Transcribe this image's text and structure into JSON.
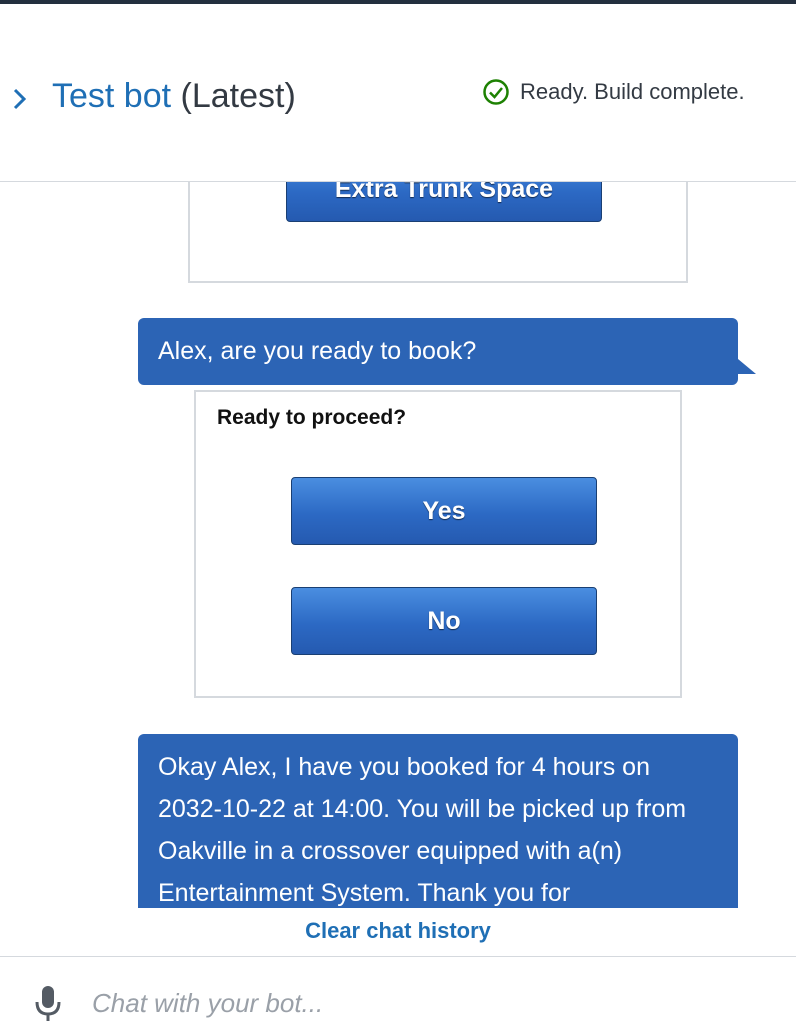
{
  "header": {
    "title_link": "Test bot",
    "title_version": "(Latest)",
    "status_text": "Ready. Build complete."
  },
  "chat": {
    "card1": {
      "button_label": "Extra Trunk Space"
    },
    "bot_message_1": "Alex, are you ready to book?",
    "card2": {
      "title": "Ready to proceed?",
      "buttons": [
        "Yes",
        "No"
      ]
    },
    "bot_message_2": "Okay Alex, I have you booked for 4 hours on 2032-10-22 at 14:00. You will be picked up from Oakville in a crossover equipped with a(n) Entertainment System. Thank you for"
  },
  "clear_history_label": "Clear chat history",
  "input": {
    "placeholder": "Chat with your bot...",
    "value": ""
  },
  "colors": {
    "accent": "#1f6fb5",
    "bubble": "#2c64b5",
    "success": "#1d8102"
  },
  "icons": [
    "chevron-right-icon",
    "check-circle-icon",
    "microphone-icon"
  ]
}
